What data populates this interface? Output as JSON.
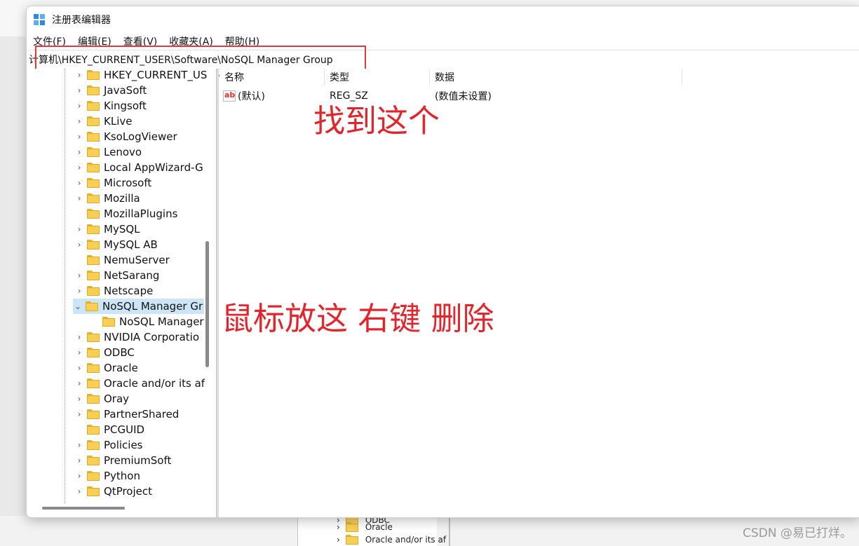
{
  "window": {
    "title": "注册表编辑器"
  },
  "menu": [
    "文件(F)",
    "编辑(E)",
    "查看(V)",
    "收藏夹(A)",
    "帮助(H)"
  ],
  "address": "计算机\\HKEY_CURRENT_USER\\Software\\NoSQL Manager Group",
  "tree": [
    {
      "label": "HKEY_CURRENT_US",
      "chevron": "›",
      "indent": 1
    },
    {
      "label": "JavaSoft",
      "chevron": "›",
      "indent": 1
    },
    {
      "label": "Kingsoft",
      "chevron": "›",
      "indent": 1
    },
    {
      "label": "KLive",
      "chevron": "›",
      "indent": 1
    },
    {
      "label": "KsoLogViewer",
      "chevron": "›",
      "indent": 1
    },
    {
      "label": "Lenovo",
      "chevron": "›",
      "indent": 1
    },
    {
      "label": "Local AppWizard-G",
      "chevron": "›",
      "indent": 1
    },
    {
      "label": "Microsoft",
      "chevron": "›",
      "indent": 1
    },
    {
      "label": "Mozilla",
      "chevron": "›",
      "indent": 1
    },
    {
      "label": "MozillaPlugins",
      "chevron": "",
      "indent": 1
    },
    {
      "label": "MySQL",
      "chevron": "›",
      "indent": 1
    },
    {
      "label": "MySQL AB",
      "chevron": "›",
      "indent": 1
    },
    {
      "label": "NemuServer",
      "chevron": "",
      "indent": 1
    },
    {
      "label": "NetSarang",
      "chevron": "›",
      "indent": 1
    },
    {
      "label": "Netscape",
      "chevron": "›",
      "indent": 1
    },
    {
      "label": "NoSQL Manager Gr",
      "chevron": "⌄",
      "indent": 1,
      "selected": true
    },
    {
      "label": "NoSQL Manager",
      "chevron": "",
      "indent": 2
    },
    {
      "label": "NVIDIA Corporatio",
      "chevron": "›",
      "indent": 1
    },
    {
      "label": "ODBC",
      "chevron": "›",
      "indent": 1
    },
    {
      "label": "Oracle",
      "chevron": "›",
      "indent": 1
    },
    {
      "label": "Oracle and/or its af",
      "chevron": "›",
      "indent": 1
    },
    {
      "label": "Oray",
      "chevron": "›",
      "indent": 1
    },
    {
      "label": "PartnerShared",
      "chevron": "›",
      "indent": 1
    },
    {
      "label": "PCGUID",
      "chevron": "",
      "indent": 1
    },
    {
      "label": "Policies",
      "chevron": "›",
      "indent": 1
    },
    {
      "label": "PremiumSoft",
      "chevron": "›",
      "indent": 1
    },
    {
      "label": "Python",
      "chevron": "›",
      "indent": 1
    },
    {
      "label": "QtProject",
      "chevron": "›",
      "indent": 1
    }
  ],
  "columns": {
    "name": "名称",
    "type": "类型",
    "data": "数据"
  },
  "values": [
    {
      "name": "(默认)",
      "type": "REG_SZ",
      "data": "(数值未设置)"
    }
  ],
  "annotations": {
    "find_this": "找到这个",
    "right_click_delete": "鼠标放这 右键 删除"
  },
  "background": {
    "tree_items": [
      "ODBC",
      "Oracle",
      "Oracle and/or its af"
    ],
    "watermark": "CSDN @易已打烊。"
  },
  "colors": {
    "annotation": "#e0262c",
    "selection": "#cde6f7",
    "folder": "#f8cf55"
  }
}
